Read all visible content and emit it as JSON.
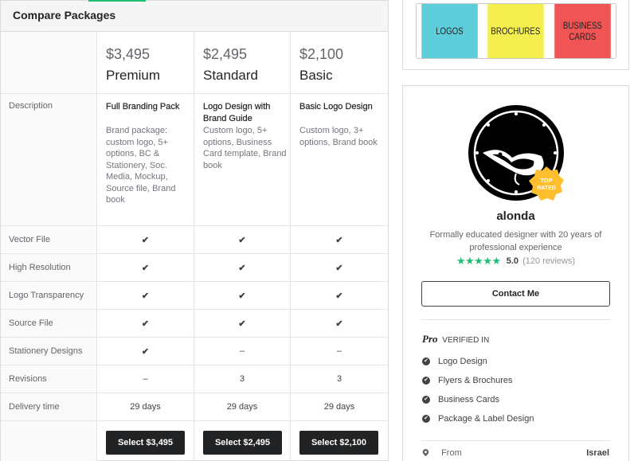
{
  "compare": {
    "title": "Compare Packages",
    "packages": [
      {
        "price": "$3,495",
        "name": "Premium",
        "desc_title": "Full Branding Pack",
        "desc_text": "Brand package: custom logo, 5+ options, BC & Stationery, Soc. Media, Mockup, Source file, Brand book",
        "select_label": "Select $3,495"
      },
      {
        "price": "$2,495",
        "name": "Standard",
        "desc_title": "Logo Design with Brand Guide",
        "desc_text": "Custom logo, 5+ options, Business Card template, Brand book",
        "select_label": "Select $2,495"
      },
      {
        "price": "$2,100",
        "name": "Basic",
        "desc_title": "Basic Logo Design",
        "desc_text": "Custom logo, 3+ options, Brand book",
        "select_label": "Select $2,100"
      }
    ],
    "description_label": "Description",
    "features": [
      {
        "label": "Vector File",
        "values": [
          "✔",
          "✔",
          "✔"
        ]
      },
      {
        "label": "High Resolution",
        "values": [
          "✔",
          "✔",
          "✔"
        ]
      },
      {
        "label": "Logo Transparency",
        "values": [
          "✔",
          "✔",
          "✔"
        ]
      },
      {
        "label": "Source File",
        "values": [
          "✔",
          "✔",
          "✔"
        ]
      },
      {
        "label": "Stationery Designs",
        "values": [
          "✔",
          "–",
          "–"
        ]
      },
      {
        "label": "Revisions",
        "values": [
          "–",
          "3",
          "3"
        ]
      },
      {
        "label": "Delivery time",
        "values": [
          "29 days",
          "29 days",
          "29 days"
        ]
      }
    ]
  },
  "gig_thumbs": [
    {
      "lines": [
        "LOGOS"
      ],
      "color": "#5ccdd9"
    },
    {
      "lines": [
        "BROCHURES"
      ],
      "color": "#f4ef4f"
    },
    {
      "lines": [
        "BUSINESS",
        "CARDS"
      ],
      "color": "#f05454"
    }
  ],
  "seller": {
    "name": "alonda",
    "tagline": "Formally educated designer with 20 years of professional experience",
    "badge_line1": "TOP",
    "badge_line2": "RATED",
    "stars": "★★★★★",
    "rating": "5.0",
    "reviews": "(120 reviews)",
    "contact_label": "Contact Me",
    "pro_label": "Pro",
    "verified_label": "VERIFIED IN",
    "verified_items": [
      "Logo Design",
      "Flyers & Brochures",
      "Business Cards",
      "Package & Label Design"
    ],
    "from_label": "From",
    "from_value": "Israel"
  },
  "colors": {
    "accent": "#1dbf73",
    "dark_button": "#222325",
    "badge": "#ffbe2e"
  }
}
